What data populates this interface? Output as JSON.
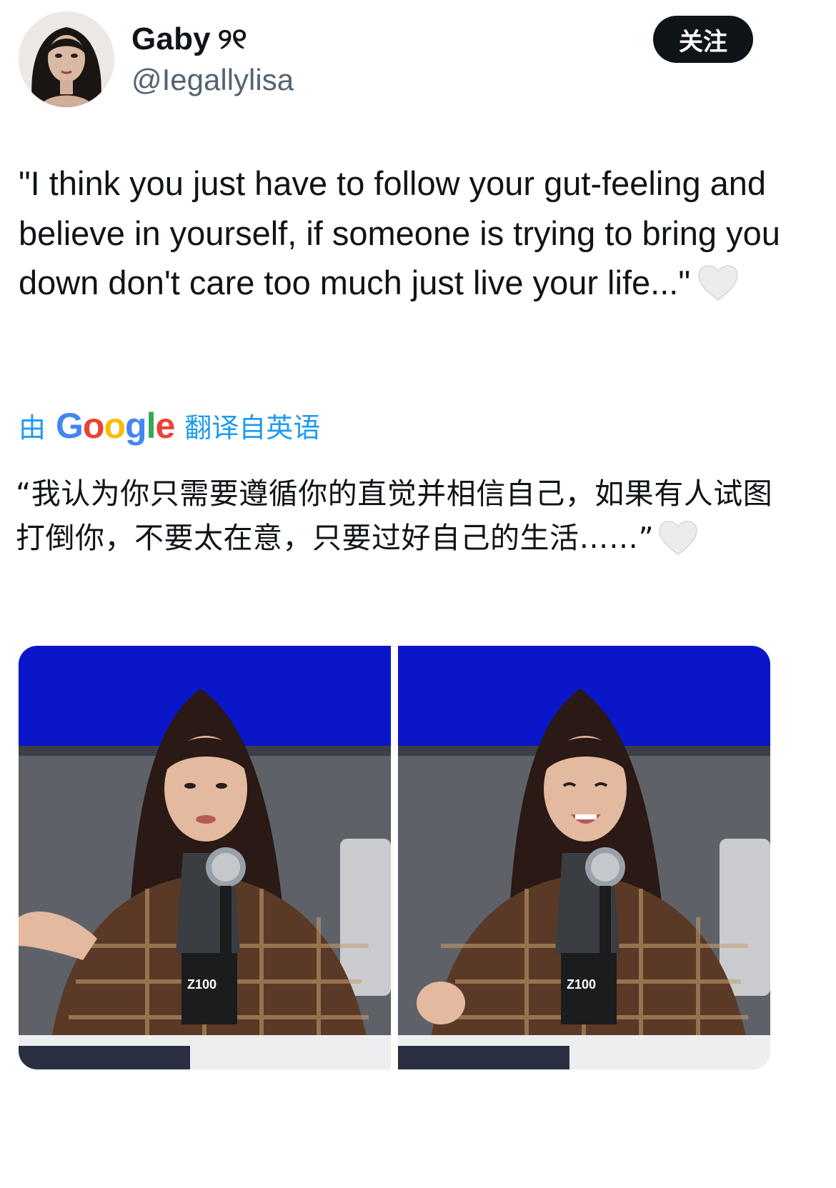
{
  "tweet": {
    "author": {
      "display_name": "Gaby",
      "name_emoji": "୨୧",
      "handle": "@Iegallylisa"
    },
    "follow_label": "关注",
    "text": "\"I think you just have to follow your gut-feeling and believe in yourself, if someone is trying to bring you down don't care too much just live your life...\"",
    "translation": {
      "prefix": "由",
      "provider": "Google",
      "suffix": "翻译自英语",
      "text": "“我认为你只需要遵循你的直觉并相信自己，如果有人试图打倒你，不要太在意，只要过好自己的生活……”"
    },
    "media": [
      {
        "kind": "photo",
        "logo_text": "Z100"
      },
      {
        "kind": "photo",
        "logo_text": "Z100"
      }
    ]
  },
  "colors": {
    "text": "#0f1419",
    "secondary": "#536471",
    "link": "#1d9bf0",
    "heart": "#e8e8e8",
    "backdrop_blue": "#0a16c8"
  },
  "icons": {
    "inline_emoji": "white-heart-icon"
  }
}
